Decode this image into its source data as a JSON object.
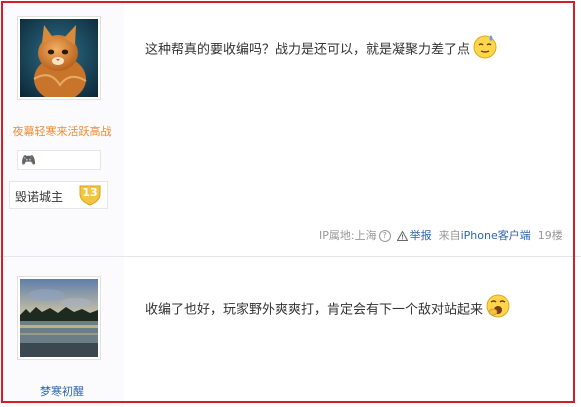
{
  "posts": [
    {
      "user": {
        "name": "夜幕轻寒来活跃高战",
        "badge_text": "🎮",
        "title": "毁诺城主",
        "level": "13"
      },
      "content": "这种帮真的要收编吗？战力是还可以，就是凝聚力差了点",
      "footer": {
        "ip_location": "IP属地:上海",
        "report": "举报",
        "source_prefix": "来自",
        "client": "iPhone客户端",
        "floor": "19楼"
      }
    },
    {
      "user": {
        "name": "梦寒初醒"
      },
      "content": "收编了也好，玩家野外爽爽打，肯定会有下一个敌对站起来"
    }
  ],
  "icons": {
    "help": "question-circle-icon",
    "report": "warning-triangle-icon",
    "emoji_1": "sweat-smile-emoji",
    "emoji_2": "yawn-emoji"
  },
  "colors": {
    "frame": "#d21f26",
    "username_1": "#f08a30",
    "username_2": "#2d64b3",
    "link": "#2d64b3",
    "level_badge": "#f5c542"
  }
}
